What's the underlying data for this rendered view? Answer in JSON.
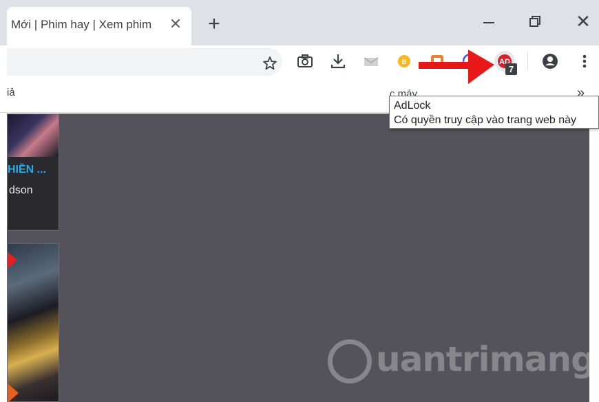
{
  "tab": {
    "title": "Mới | Phim hay | Xem phim",
    "close_glyph": "✕"
  },
  "window": {
    "new_tab_glyph": "+",
    "close_glyph": "✕"
  },
  "toolbar": {
    "extension_badge": "7"
  },
  "bookmarks": {
    "left_label": "iả",
    "mid_label": "c máy",
    "more_glyph": "»"
  },
  "tooltip": {
    "title": "AdLock",
    "description": "Có quyền truy cập vào trang web này"
  },
  "page": {
    "card1_title": "HIỀN ...",
    "card1_subtitle": "dson",
    "watermark": "uantrimang"
  },
  "colors": {
    "annotation_arrow": "#e81818",
    "adlock_icon": "#d8202c",
    "card_title": "#2aa8e8",
    "page_background": "#54525a"
  }
}
